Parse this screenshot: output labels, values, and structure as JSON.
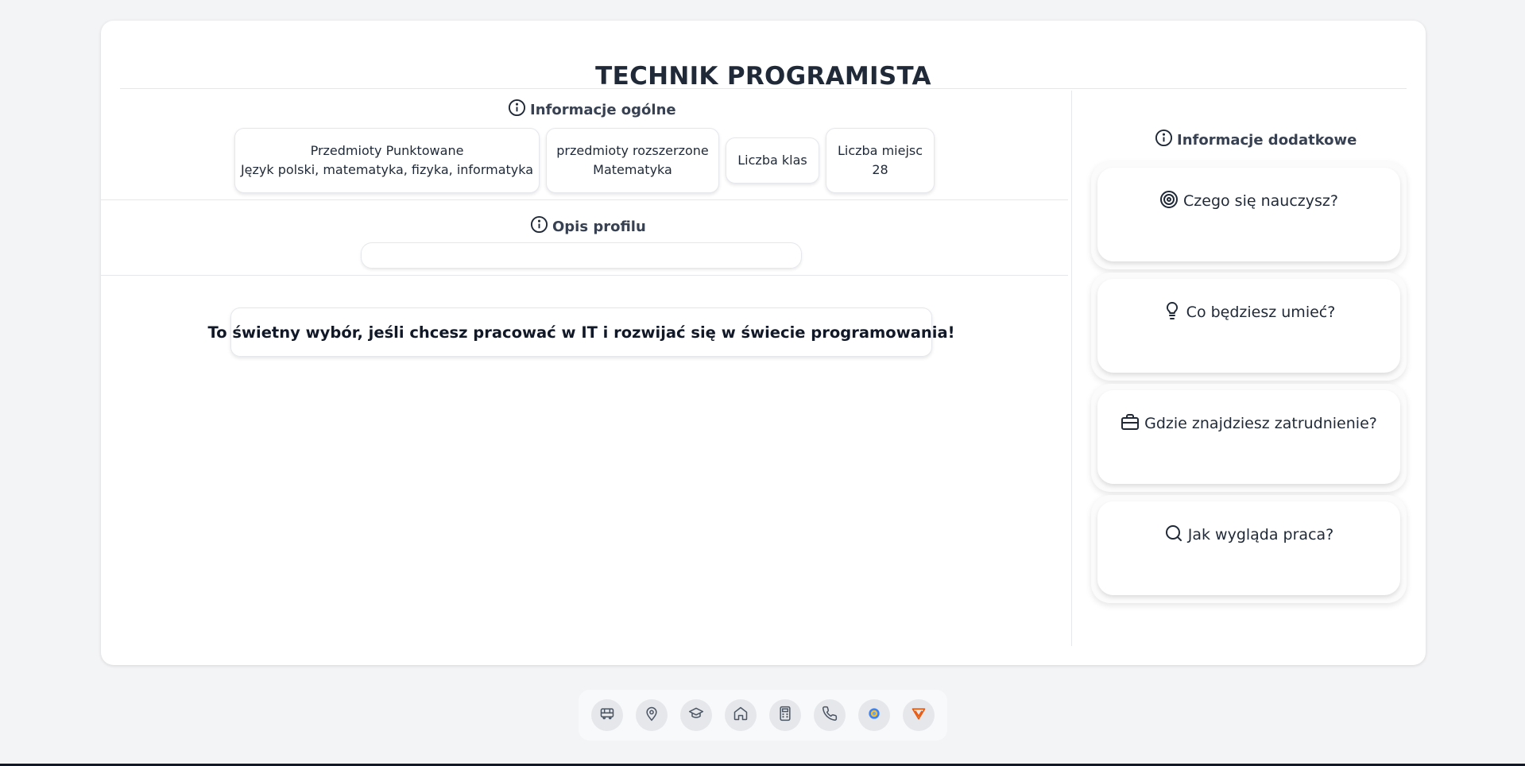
{
  "page": {
    "title": "TECHNIK PROGRAMISTA"
  },
  "general": {
    "heading": "Informacje ogólne",
    "chips": [
      {
        "label": "Przedmioty Punktowane",
        "value": "Język polski, matematyka, fizyka, informatyka"
      },
      {
        "label": "przedmioty rozszerzone",
        "value": "Matematyka"
      },
      {
        "label": "Liczba klas",
        "value": ""
      },
      {
        "label": "Liczba miejsc",
        "value": "28"
      }
    ]
  },
  "profile": {
    "heading": "Opis profilu",
    "description": ""
  },
  "banner": {
    "text": "To świetny wybór, jeśli chcesz pracować w IT i rozwijać się w świecie programowania!"
  },
  "additional": {
    "heading": "Informacje dodatkowe",
    "cards": [
      {
        "label": "Czego się nauczysz?",
        "icon": "target-icon"
      },
      {
        "label": "Co będziesz umieć?",
        "icon": "lightbulb-icon"
      },
      {
        "label": "Gdzie znajdziesz zatrudnienie?",
        "icon": "briefcase-icon"
      },
      {
        "label": "Jak wygląda praca?",
        "icon": "search-icon"
      }
    ]
  },
  "dock": {
    "items": [
      "bus-icon",
      "map-pin-icon",
      "graduation-cap-icon",
      "home-icon",
      "calculator-icon",
      "phone-icon",
      "app-logo-icon",
      "brand-logo-icon"
    ]
  },
  "colors": {
    "background": "#f3f4f6",
    "card": "#ffffff",
    "text": "#1f2937",
    "border": "#e5e7eb"
  }
}
